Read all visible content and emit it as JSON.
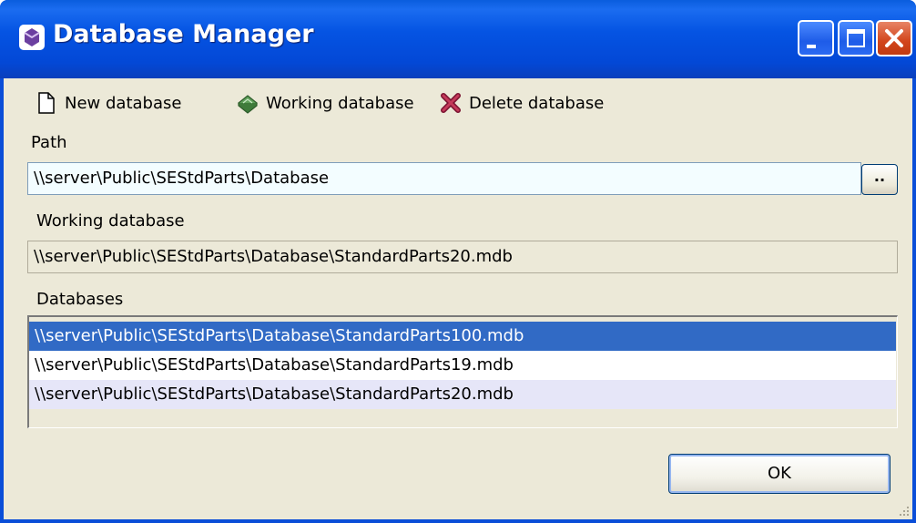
{
  "window": {
    "title": "Database Manager"
  },
  "toolbar": {
    "new_label": "New database",
    "working_label": "Working database",
    "delete_label": "Delete database"
  },
  "path": {
    "label": "Path",
    "value": "\\\\server\\Public\\SEStdParts\\Database",
    "browse_label": ".."
  },
  "working": {
    "label": "Working database",
    "value": "\\\\server\\Public\\SEStdParts\\Database\\StandardParts20.mdb"
  },
  "databases": {
    "label": "Databases",
    "items": [
      "\\\\server\\Public\\SEStdParts\\Database\\StandardParts100.mdb",
      "\\\\server\\Public\\SEStdParts\\Database\\StandardParts19.mdb",
      "\\\\server\\Public\\SEStdParts\\Database\\StandardParts20.mdb"
    ],
    "selected_index": 0
  },
  "footer": {
    "ok_label": "OK"
  },
  "colors": {
    "title_bar": "#0a4ed8",
    "dialog_bg": "#ece9d8",
    "selection": "#316ac5",
    "close_button": "#d2451b"
  }
}
